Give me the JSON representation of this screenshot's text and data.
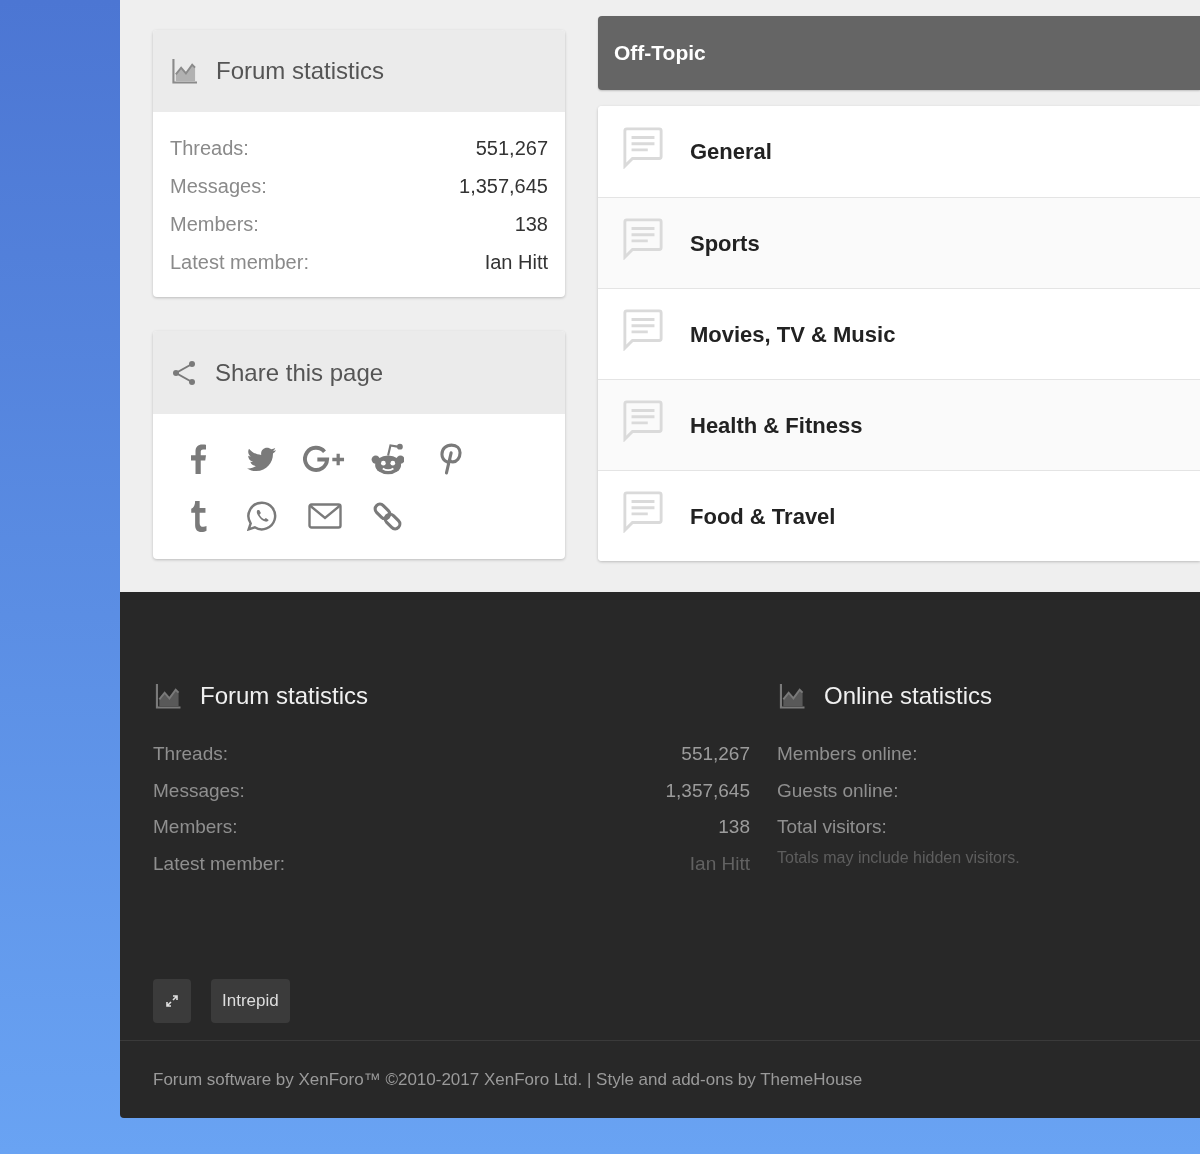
{
  "sidebar_stats": {
    "title": "Forum statistics",
    "rows": [
      {
        "label": "Threads:",
        "value": "551,267"
      },
      {
        "label": "Messages:",
        "value": "1,357,645"
      },
      {
        "label": "Members:",
        "value": "138"
      },
      {
        "label": "Latest member:",
        "value": "Ian Hitt"
      }
    ]
  },
  "share_widget": {
    "title": "Share this page",
    "links": [
      {
        "kind": "facebook"
      },
      {
        "kind": "twitter"
      },
      {
        "kind": "googleplus"
      },
      {
        "kind": "reddit"
      },
      {
        "kind": "pinterest"
      },
      {
        "kind": "tumblr"
      },
      {
        "kind": "whatsapp"
      },
      {
        "kind": "email"
      },
      {
        "kind": "link"
      }
    ]
  },
  "category": {
    "title": "Off-Topic",
    "forums": [
      {
        "title": "General"
      },
      {
        "title": "Sports"
      },
      {
        "title": "Movies, TV & Music"
      },
      {
        "title": "Health & Fitness"
      },
      {
        "title": "Food & Travel"
      }
    ]
  },
  "footer": {
    "forum_statistics": {
      "title": "Forum statistics",
      "rows": [
        {
          "label": "Threads:",
          "value": "551,267",
          "kind": "count"
        },
        {
          "label": "Messages:",
          "value": "1,357,645",
          "kind": "count"
        },
        {
          "label": "Members:",
          "value": "138",
          "kind": "count"
        },
        {
          "label": "Latest member:",
          "value": "Ian Hitt",
          "kind": "member"
        }
      ]
    },
    "online_statistics": {
      "title": "Online statistics",
      "rows": [
        {
          "label": "Members online:"
        },
        {
          "label": "Guests online:"
        },
        {
          "label": "Total visitors:"
        }
      ],
      "note": "Totals may include hidden visitors."
    },
    "buttons": [
      {
        "kind": "expand"
      },
      {
        "kind": "text",
        "label": "Intrepid"
      }
    ],
    "copyright": "Forum software by XenForo™ ©2010-2017 XenForo Ltd. | Style and add-ons by ThemeHouse"
  }
}
